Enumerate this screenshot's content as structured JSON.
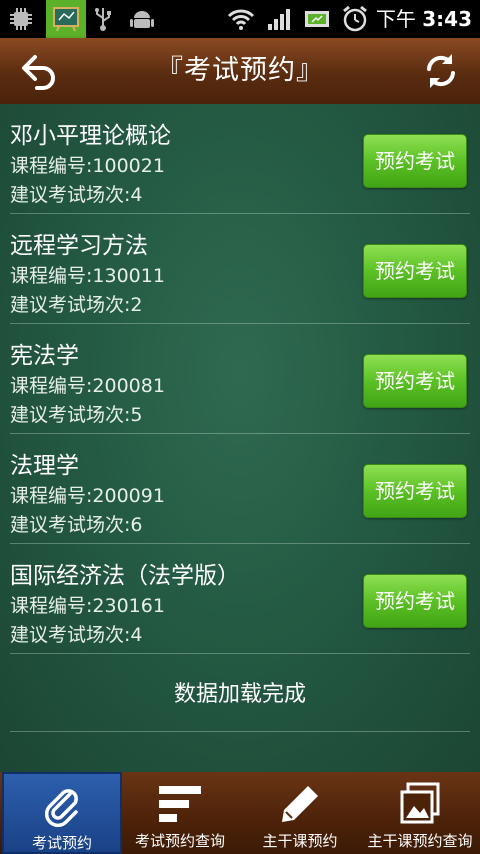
{
  "status_bar": {
    "time_prefix": "下午",
    "time": "3:43"
  },
  "header": {
    "title": "『考试预约』",
    "back_icon": "undo-arrow-icon",
    "refresh_icon": "refresh-icon"
  },
  "courses": [
    {
      "name": "邓小平理论概论",
      "code": "课程编号:100021",
      "times": "建议考试场次:4",
      "button": "预约考试"
    },
    {
      "name": "远程学习方法",
      "code": "课程编号:130011",
      "times": "建议考试场次:2",
      "button": "预约考试"
    },
    {
      "name": "宪法学",
      "code": "课程编号:200081",
      "times": "建议考试场次:5",
      "button": "预约考试"
    },
    {
      "name": "法理学",
      "code": "课程编号:200091",
      "times": "建议考试场次:6",
      "button": "预约考试"
    },
    {
      "name": "国际经济法（法学版）",
      "code": "课程编号:230161",
      "times": "建议考试场次:4",
      "button": "预约考试"
    }
  ],
  "loaded_text": "数据加载完成",
  "tabs": [
    {
      "label": "考试预约",
      "icon": "paperclip-icon",
      "active": true
    },
    {
      "label": "考试预约查询",
      "icon": "list-icon",
      "active": false
    },
    {
      "label": "主干课预约",
      "icon": "pencil-icon",
      "active": false
    },
    {
      "label": "主干课预约查询",
      "icon": "gallery-icon",
      "active": false
    }
  ],
  "colors": {
    "board": "#245a43",
    "header": "#5a2c10",
    "button": "#5cc126",
    "active_tab": "#2d5fae"
  }
}
